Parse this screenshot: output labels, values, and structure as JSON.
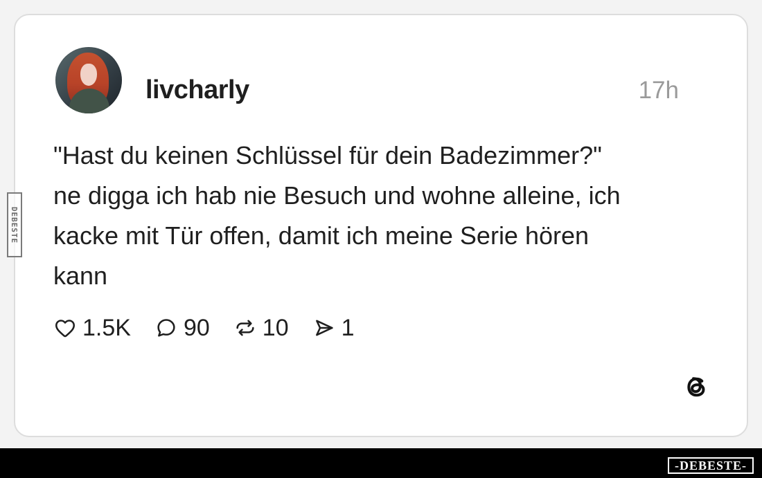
{
  "post": {
    "username": "livcharly",
    "timestamp": "17h",
    "text": "\"Hast du keinen Schlüssel für dein Badezimmer?\"\nne digga ich hab nie Besuch und wohne alleine, ich\nkacke mit Tür offen, damit ich meine Serie hören\nkann",
    "stats": {
      "likes": "1.5K",
      "replies": "90",
      "reposts": "10",
      "shares": "1"
    }
  },
  "watermarks": {
    "side": "DEBESTE",
    "bottom": "-DEBESTE-"
  },
  "icons": {
    "avatar": "profile-avatar",
    "like": "heart-icon",
    "reply": "speech-bubble-icon",
    "repost": "repost-icon",
    "share": "paper-plane-icon",
    "logo": "threads-logo"
  },
  "colors": {
    "card_background": "#ffffff",
    "page_background": "#f3f3f3",
    "text": "#1f1f1f",
    "muted": "#9a9a9a",
    "border": "#dddddd",
    "footer": "#000000"
  }
}
